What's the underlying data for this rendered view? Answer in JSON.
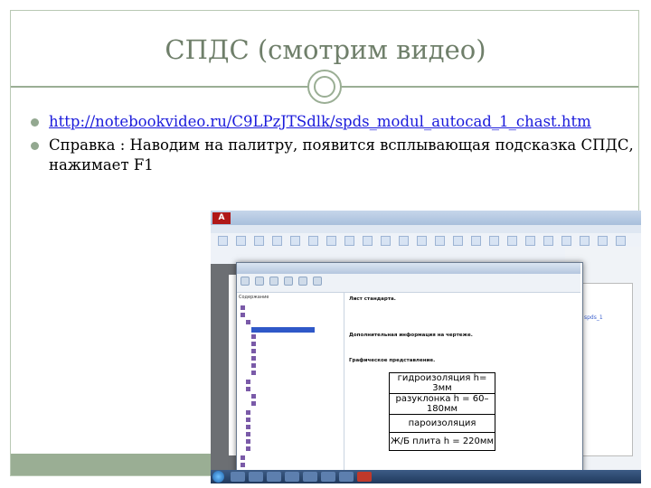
{
  "slide": {
    "title": "СПДС (смотрим видео)",
    "bullets": [
      {
        "type": "link",
        "text": "http://notebookvideo.ru/C9LPzJTSdlk/spds_modul_autocad_1_chast.htm"
      },
      {
        "type": "text",
        "text": "Справка : Наводим на палитру, появится всплывающая подсказка СПДС, нажимает F1"
      }
    ]
  },
  "screenshot": {
    "cad_logo": "A",
    "help_tree_tab": "Содержание",
    "help_body": {
      "heading1": "Лист стандарта.",
      "heading2": "Дополнительная информация на чертеже.",
      "heading3": "Графическое представление."
    },
    "table_rows": [
      "гидроизоляция h= 3мм",
      "разуклонка h = 60–180мм",
      "пароизоляция",
      "Ж/Б плита h = 220мм"
    ],
    "word_link": "spds_1"
  }
}
